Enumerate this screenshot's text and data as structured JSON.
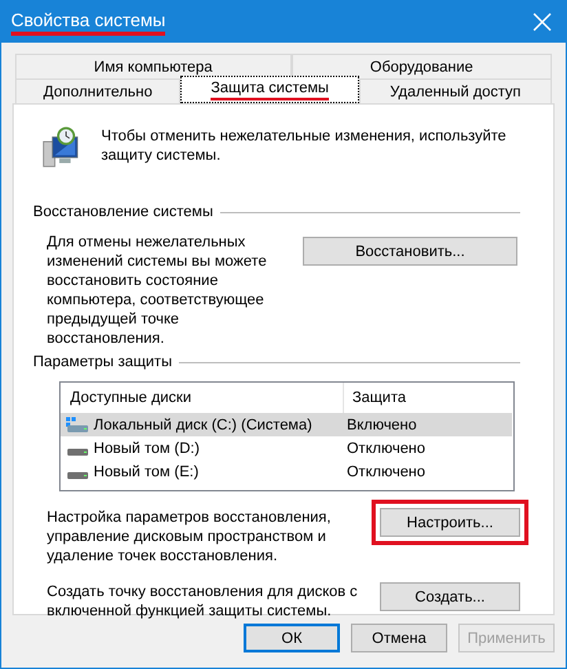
{
  "window": {
    "title": "Свойства системы",
    "title_highlighted": true
  },
  "tabs": [
    [
      {
        "label": "Имя компьютера",
        "selected": false,
        "highlighted": false
      },
      {
        "label": "Оборудование",
        "selected": false,
        "highlighted": false
      }
    ],
    [
      {
        "label": "Дополнительно",
        "selected": false,
        "highlighted": false
      },
      {
        "label": "Защита системы",
        "selected": true,
        "highlighted": true
      },
      {
        "label": "Удаленный доступ",
        "selected": false,
        "highlighted": false
      }
    ]
  ],
  "intro": "Чтобы отменить нежелательные изменения, используйте защиту системы.",
  "restore_group": {
    "title": "Восстановление системы",
    "text": "Для отмены нежелательных изменений системы вы можете восстановить состояние компьютера, соответствующее предыдущей точке восстановления.",
    "button": {
      "label": "Восстановить...",
      "highlighted": false
    }
  },
  "protection_group": {
    "title": "Параметры защиты",
    "columns": [
      "Доступные диски",
      "Защита"
    ],
    "rows": [
      {
        "kind": "system",
        "drive": "Локальный диск (C:) (Система)",
        "protection": "Включено",
        "selected": true
      },
      {
        "kind": "plain",
        "drive": "Новый том (D:)",
        "protection": "Отключено",
        "selected": false
      },
      {
        "kind": "plain",
        "drive": "Новый том (E:)",
        "protection": "Отключено",
        "selected": false
      }
    ],
    "actions": [
      {
        "text": "Настройка параметров восстановления, управление дисковым пространством и удаление точек восстановления.",
        "button": {
          "label": "Настроить...",
          "highlighted": true
        }
      },
      {
        "text": "Создать точку восстановления для дисков с включенной функцией защиты системы.",
        "button": {
          "label": "Создать...",
          "highlighted": false
        }
      }
    ]
  },
  "buttons": [
    {
      "label": "ОК",
      "focused": true,
      "disabled": false
    },
    {
      "label": "Отмена",
      "focused": false,
      "disabled": false
    },
    {
      "label": "Применить",
      "focused": false,
      "disabled": true
    }
  ]
}
